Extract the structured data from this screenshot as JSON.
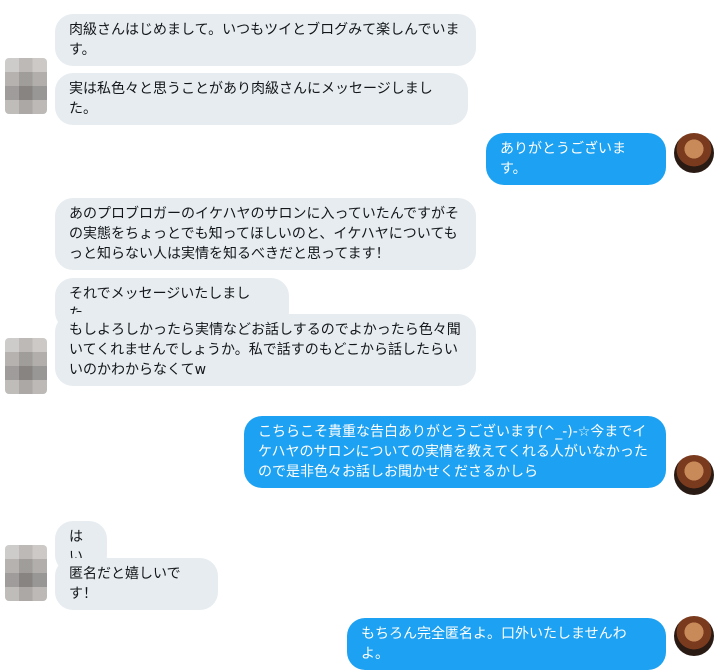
{
  "messages": [
    {
      "side": "in",
      "text": "肉級さんはじめまして。いつもツイとブログみて楽しんでいます。"
    },
    {
      "side": "in",
      "text": "実は私色々と思うことがあり肉級さんにメッセージしました。"
    },
    {
      "side": "out",
      "text": "ありがとうございます。"
    },
    {
      "side": "in",
      "text": "あのプロブロガーのイケハヤのサロンに入っていたんですがその実態をちょっとでも知ってほしいのと、イケハヤについてもっと知らない人は実情を知るべきだと思ってます！"
    },
    {
      "side": "in",
      "text": "それでメッセージいたしました。"
    },
    {
      "side": "in",
      "text": "もしよろしかったら実情などお話しするのでよかったら色々聞いてくれませんでしょうか。私で話すのもどこから話したらいいのかわからなくてw"
    },
    {
      "side": "out",
      "text": "こちらこそ貴重な告白ありがとうございます(^_-)-☆今までイケハヤのサロンについての実情を教えてくれる人がいなかったので是非色々お話しお聞かせくださるかしら"
    },
    {
      "side": "in",
      "text": "はい"
    },
    {
      "side": "in",
      "text": "匿名だと嬉しいです！"
    },
    {
      "side": "out",
      "text": "もちろん完全匿名よ。口外いたしませんわよ。"
    }
  ],
  "avatars": {
    "other": "pixelated-avatar",
    "self": "self-avatar"
  },
  "colors": {
    "incoming_bubble": "#e6ecf0",
    "outgoing_bubble": "#1da1f2"
  }
}
